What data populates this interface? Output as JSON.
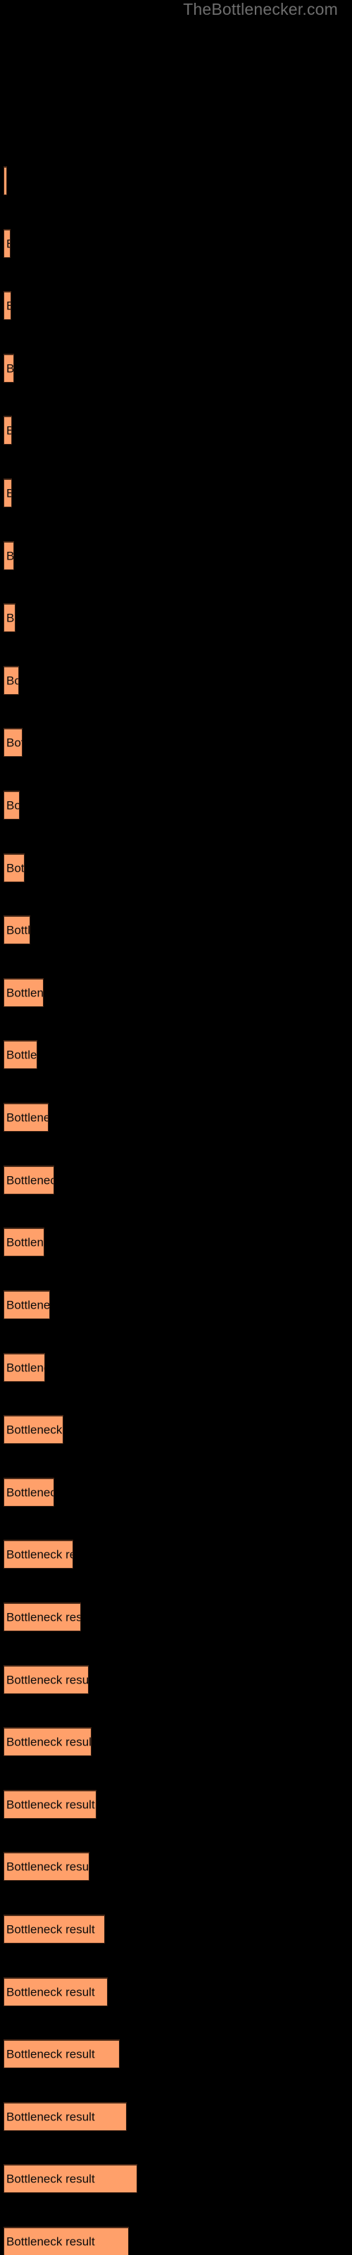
{
  "site": {
    "watermark": "TheBottlenecker.com"
  },
  "chart_data": {
    "type": "bar",
    "orientation": "horizontal",
    "title": "",
    "subtitle": "",
    "xlabel": "",
    "ylabel": "",
    "grid": false,
    "legend": null,
    "background_color": "#000000",
    "bar_color": "#FFA06A",
    "bar_edge_color": "#3A2013",
    "label_color": "#0A0A0A",
    "watermark_color": "#6E6E6E",
    "bar_label_text": "Bottleneck result",
    "xlim": [
      0,
      500
    ],
    "categories": [
      "Bottleneck result",
      "Bottleneck result",
      "Bottleneck result",
      "Bottleneck result",
      "Bottleneck result",
      "Bottleneck result",
      "Bottleneck result",
      "Bottleneck result",
      "Bottleneck result",
      "Bottleneck result",
      "Bottleneck result",
      "Bottleneck result",
      "Bottleneck result",
      "Bottleneck result",
      "Bottleneck result",
      "Bottleneck result",
      "Bottleneck result",
      "Bottleneck result",
      "Bottleneck result",
      "Bottleneck result",
      "Bottleneck result",
      "Bottleneck result",
      "Bottleneck result",
      "Bottleneck result",
      "Bottleneck result",
      "Bottleneck result",
      "Bottleneck result",
      "Bottleneck result",
      "Bottleneck result",
      "Bottleneck result",
      "Bottleneck result",
      "Bottleneck result",
      "Bottleneck result",
      "Bottleneck result"
    ],
    "values": [
      5,
      10,
      11,
      15,
      12,
      12,
      15,
      17,
      22,
      27,
      23,
      30,
      38,
      57,
      48,
      64,
      72,
      58,
      66,
      59,
      85,
      72,
      99,
      110,
      121,
      125,
      132,
      122,
      144,
      148,
      165,
      175,
      190,
      178
    ],
    "bars": [
      {
        "y": 236,
        "width": 5,
        "label": "Bottleneck result"
      },
      {
        "y": 323,
        "width": 10,
        "label": "Bottleneck result"
      },
      {
        "y": 366,
        "width": 11,
        "label": "Bottleneck result"
      },
      {
        "y": 409,
        "width": 15,
        "label": "Bottleneck result"
      },
      {
        "y": 452,
        "width": 12,
        "label": "Bottleneck result"
      },
      {
        "y": 495,
        "width": 12,
        "label": "Bottleneck result"
      },
      {
        "y": 538,
        "width": 15,
        "label": "Bottleneck result"
      },
      {
        "y": 581,
        "width": 17,
        "label": "Bottleneck result"
      },
      {
        "y": 624,
        "width": 22,
        "label": "Bottleneck result"
      },
      {
        "y": 667,
        "width": 27,
        "label": "Bottleneck result"
      },
      {
        "y": 710,
        "width": 23,
        "label": "Bottleneck result"
      },
      {
        "y": 753,
        "width": 30,
        "label": "Bottleneck result"
      },
      {
        "y": 796,
        "width": 38,
        "label": "Bottleneck result"
      },
      {
        "y": 839,
        "width": 57,
        "label": "Bottleneck result"
      },
      {
        "y": 882,
        "width": 48,
        "label": "Bottleneck result"
      },
      {
        "y": 925,
        "width": 64,
        "label": "Bottleneck result"
      },
      {
        "y": 968,
        "width": 72,
        "label": "Bottleneck result"
      },
      {
        "y": 1011,
        "width": 58,
        "label": "Bottleneck result"
      },
      {
        "y": 1054,
        "width": 66,
        "label": "Bottleneck result"
      },
      {
        "y": 1097,
        "width": 59,
        "label": "Bottleneck result"
      },
      {
        "y": 1140,
        "width": 85,
        "label": "Bottleneck result"
      },
      {
        "y": 1183,
        "width": 72,
        "label": "Bottleneck result"
      },
      {
        "y": 1226,
        "width": 99,
        "label": "Bottleneck result"
      },
      {
        "y": 1269,
        "width": 110,
        "label": "Bottleneck result"
      },
      {
        "y": 1312,
        "width": 121,
        "label": "Bottleneck result"
      },
      {
        "y": 1355,
        "width": 125,
        "label": "Bottleneck result"
      },
      {
        "y": 1398,
        "width": 132,
        "label": "Bottleneck result"
      },
      {
        "y": 1441,
        "width": 122,
        "label": "Bottleneck result"
      },
      {
        "y": 1484,
        "width": 144,
        "label": "Bottleneck result"
      },
      {
        "y": 1527,
        "width": 148,
        "label": "Bottleneck result"
      },
      {
        "y": 1570,
        "width": 165,
        "label": "Bottleneck result"
      },
      {
        "y": 1613,
        "width": 175,
        "label": "Bottleneck result"
      },
      {
        "y": 1656,
        "width": 190,
        "label": "Bottleneck result"
      },
      {
        "y": 1699,
        "width": 178,
        "label": "Bottleneck result"
      }
    ]
  }
}
